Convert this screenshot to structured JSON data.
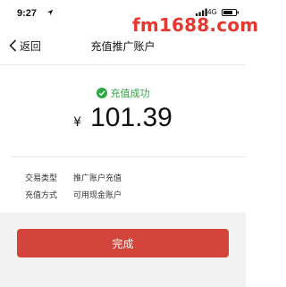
{
  "status_bar": {
    "time": "9:27",
    "network": "4G",
    "watermark": "fm1688.com"
  },
  "nav": {
    "back_label": "返回",
    "title": "充值推广账户"
  },
  "result": {
    "status_text": "充值成功",
    "currency_symbol": "¥",
    "amount": "101.39"
  },
  "details": [
    {
      "label": "交易类型",
      "value": "推广账户充值"
    },
    {
      "label": "充值方式",
      "value": "可用现金账户"
    }
  ],
  "actions": {
    "complete_label": "完成"
  },
  "colors": {
    "accent_red": "#d3453a",
    "success_green": "#2fa742",
    "watermark_red": "#e8372f"
  },
  "icons": [
    "location-arrow-icon",
    "signal-icon",
    "battery-icon",
    "back-chevron-icon",
    "check-circle-icon"
  ]
}
